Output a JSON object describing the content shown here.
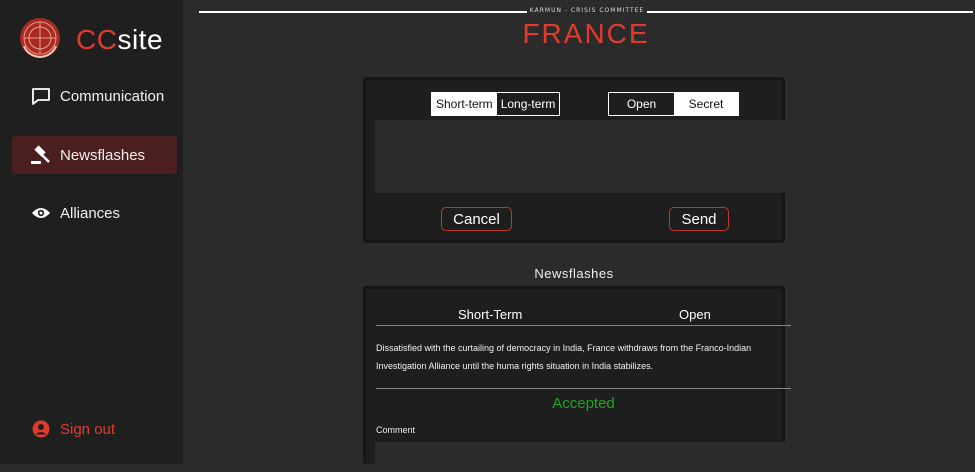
{
  "brand": {
    "prefix": "CC",
    "suffix": "site",
    "logo_icon": "un-emblem-icon"
  },
  "sidebar": {
    "items": [
      {
        "label": "Communication",
        "icon": "chat-bubble-icon",
        "active": false
      },
      {
        "label": "Newsflashes",
        "icon": "gavel-icon",
        "active": true
      },
      {
        "label": "Alliances",
        "icon": "eye-icon",
        "active": false
      }
    ],
    "signout": {
      "label": "Sign out",
      "icon": "user-circle-icon"
    }
  },
  "header": {
    "committee": "KARMUN - CRISIS COMMITTEE",
    "country": "FRANCE"
  },
  "compose": {
    "term_options": [
      "Short-term",
      "Long-term"
    ],
    "term_selected": "Short-term",
    "visibility_options": [
      "Open",
      "Secret"
    ],
    "visibility_selected": "Secret",
    "cancel_label": "Cancel",
    "send_label": "Send"
  },
  "newsflashes": {
    "title": "Newsflashes",
    "items": [
      {
        "term": "Short-Term",
        "visibility": "Open",
        "text": "Dissatisfied with the curtailing of democracy in India, France withdraws from the Franco-Indian Investigation Alliance until the huma rights situation in India stabilizes.",
        "status": "Accepted",
        "comment_label": "Comment"
      }
    ]
  },
  "colors": {
    "accent": "#e23b2e",
    "accepted": "#1ea51e",
    "sidebar_bg": "#1f1f1f",
    "main_bg": "#2b2b2b",
    "active_bg": "#4a1f1d"
  }
}
